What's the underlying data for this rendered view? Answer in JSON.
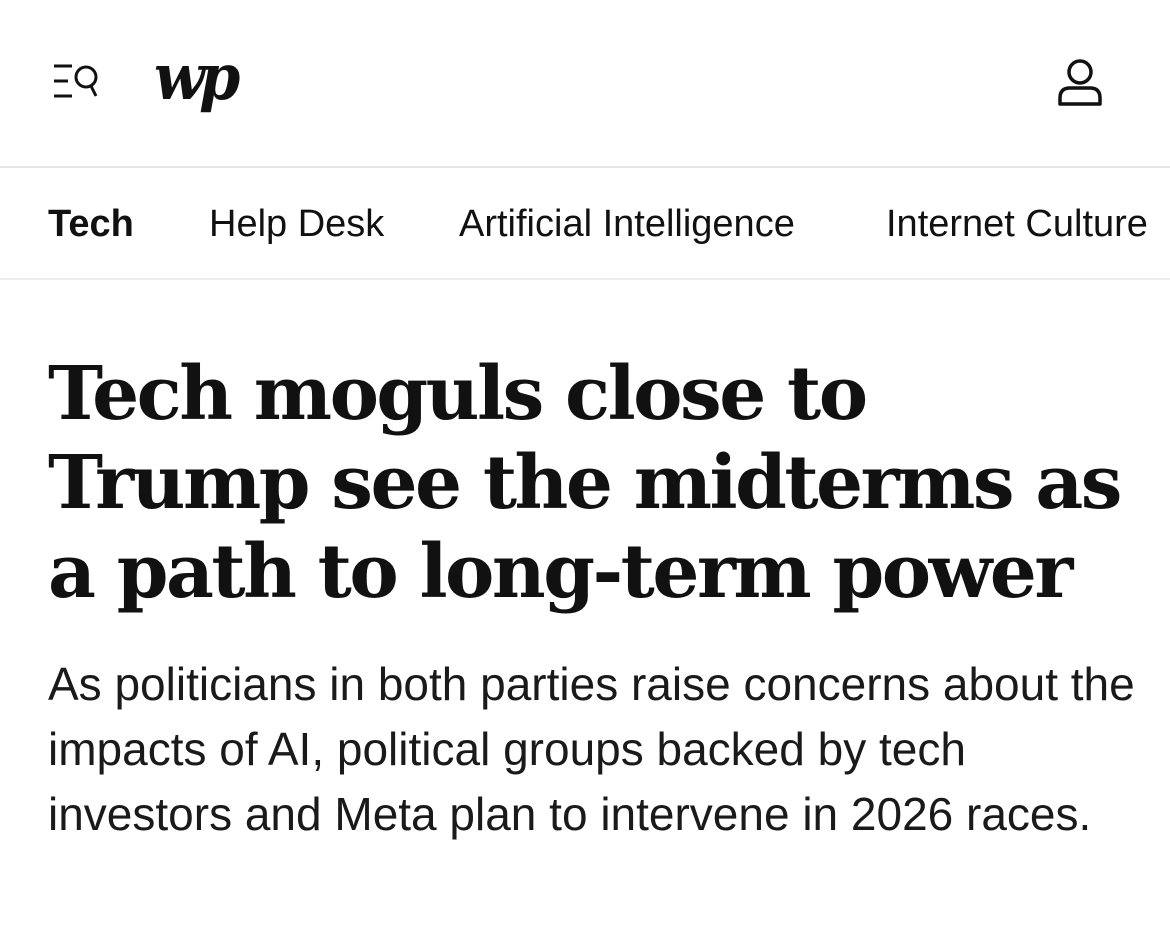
{
  "header": {
    "menu_icon": "menu-search-icon",
    "logo_text": "wp",
    "account_icon": "user-account-icon"
  },
  "subnav": {
    "items": [
      {
        "label": "Tech",
        "active": true
      },
      {
        "label": "Help Desk",
        "active": false
      },
      {
        "label": "Artificial Intelligence",
        "active": false
      },
      {
        "label": "Internet Culture",
        "active": false
      }
    ]
  },
  "article": {
    "headline": "Tech moguls close to Trump see the midterms as a path to long-term power",
    "dek": "As politicians in both parties raise concerns about the impacts of AI, political groups backed by tech investors and Meta plan to intervene in 2026 races."
  }
}
